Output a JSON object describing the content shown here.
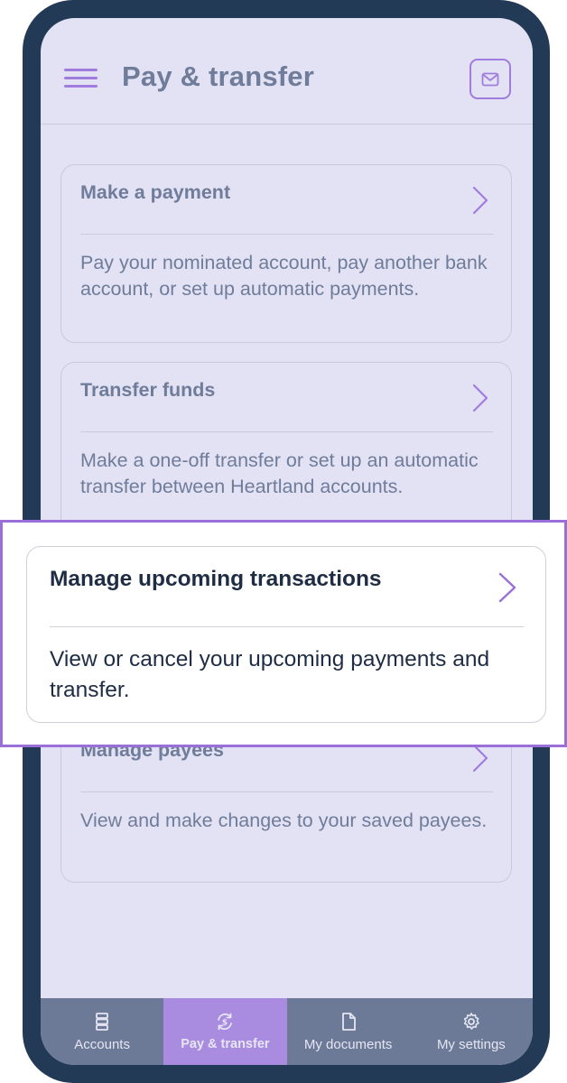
{
  "header": {
    "title": "Pay & transfer",
    "menu_icon": "hamburger-icon",
    "mail_icon": "envelope-icon"
  },
  "cards": [
    {
      "title": "Make a payment",
      "description": "Pay your nominated account, pay another bank account, or set up automatic payments."
    },
    {
      "title": "Transfer funds",
      "description": "Make a one-off transfer or set up an automatic transfer between Heartland accounts."
    },
    {
      "title": "Manage upcoming transactions",
      "description": "View or cancel your upcoming payments and transfer."
    },
    {
      "title": "Manage payees",
      "description": "View and make changes to your saved payees."
    }
  ],
  "tabs": [
    {
      "label": "Accounts",
      "icon": "stack-icon",
      "active": false
    },
    {
      "label": "Pay & transfer",
      "icon": "dollar-refresh-icon",
      "active": true
    },
    {
      "label": "My documents",
      "icon": "document-icon",
      "active": false
    },
    {
      "label": "My settings",
      "icon": "gear-icon",
      "active": false
    }
  ],
  "colors": {
    "accent": "#a07cde",
    "frame": "#233a57",
    "screen_bg": "#e3e2f5",
    "muted_text": "#6f7c9a",
    "tabbar": "#6c7a98",
    "active_tab": "#a98be0",
    "highlight_border": "#9a70d8",
    "dark_text": "#1e2c44"
  }
}
